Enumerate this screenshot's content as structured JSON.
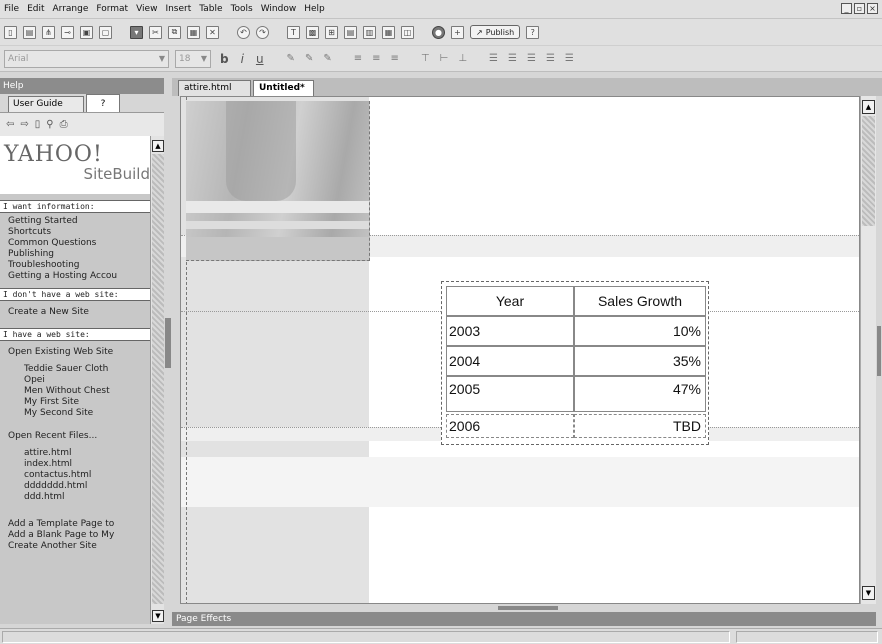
{
  "menu": [
    "File",
    "Edit",
    "Arrange",
    "Format",
    "View",
    "Insert",
    "Table",
    "Tools",
    "Window",
    "Help"
  ],
  "toolbar": {
    "publish_label": "Publish"
  },
  "format_bar": {
    "font_value": "Arial",
    "size_value": "18"
  },
  "help": {
    "title": "Help",
    "tab_guide": "User Guide",
    "tab_question": "?",
    "logo_yahoo": "YAHOO!",
    "logo_site": "SiteBuild",
    "sections": [
      {
        "header": "I want information:",
        "items": [
          "Getting Started",
          "Shortcuts",
          "Common Questions",
          "Publishing",
          "Troubleshooting",
          "Getting a Hosting Accou"
        ]
      },
      {
        "header": "I don't have a web site:",
        "items": [
          "Create a New Site"
        ]
      },
      {
        "header": "I have a web site:",
        "items": [
          "Open Existing Web Site"
        ]
      }
    ],
    "existing_sites": [
      "Teddie Sauer Cloth",
      "Opei",
      "Men Without Chest",
      "My First Site",
      "My Second Site"
    ],
    "open_recent": "Open Recent Files...",
    "recent_files": [
      "attire.html",
      "index.html",
      "contactus.html",
      "ddddddd.html",
      "ddd.html"
    ],
    "actions": [
      "Add a Template Page to",
      "Add a Blank Page to My",
      "Create Another Site"
    ]
  },
  "doc_tabs": [
    "attire.html",
    "Untitled*"
  ],
  "table": {
    "headers": [
      "Year",
      "Sales Growth"
    ],
    "rows": [
      [
        "2003",
        "10%"
      ],
      [
        "2004",
        "35%"
      ],
      [
        "2005",
        "47%"
      ],
      [
        "2006",
        "TBD"
      ]
    ]
  },
  "bottom_panel": "Page Effects"
}
